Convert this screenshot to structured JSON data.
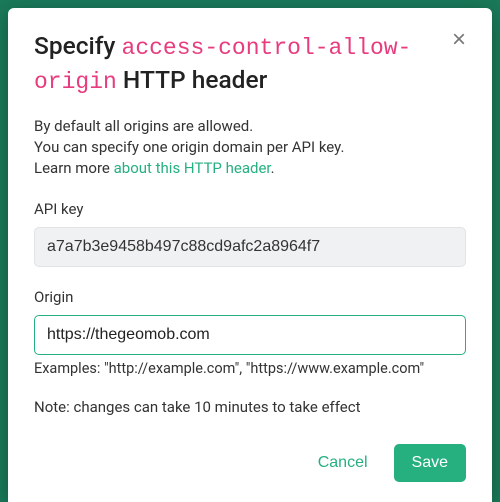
{
  "header": {
    "title_prefix": "Specify",
    "title_code": "access-control-allow-origin",
    "title_suffix": "HTTP header",
    "close_symbol": "×"
  },
  "intro": {
    "line1": "By default all origins are allowed.",
    "line2": "You can specify one origin domain per API key.",
    "learn_prefix": "Learn more ",
    "learn_link": "about this HTTP header",
    "learn_suffix": "."
  },
  "apikey": {
    "label": "API key",
    "value": "a7a7b3e9458b497c88cd9afc2a8964f7"
  },
  "origin": {
    "label": "Origin",
    "value": "https://thegeomob.com",
    "examples": "Examples: \"http://example.com\", \"https://www.example.com\""
  },
  "note": "Note: changes can take 10 minutes to take effect",
  "actions": {
    "cancel": "Cancel",
    "save": "Save"
  }
}
